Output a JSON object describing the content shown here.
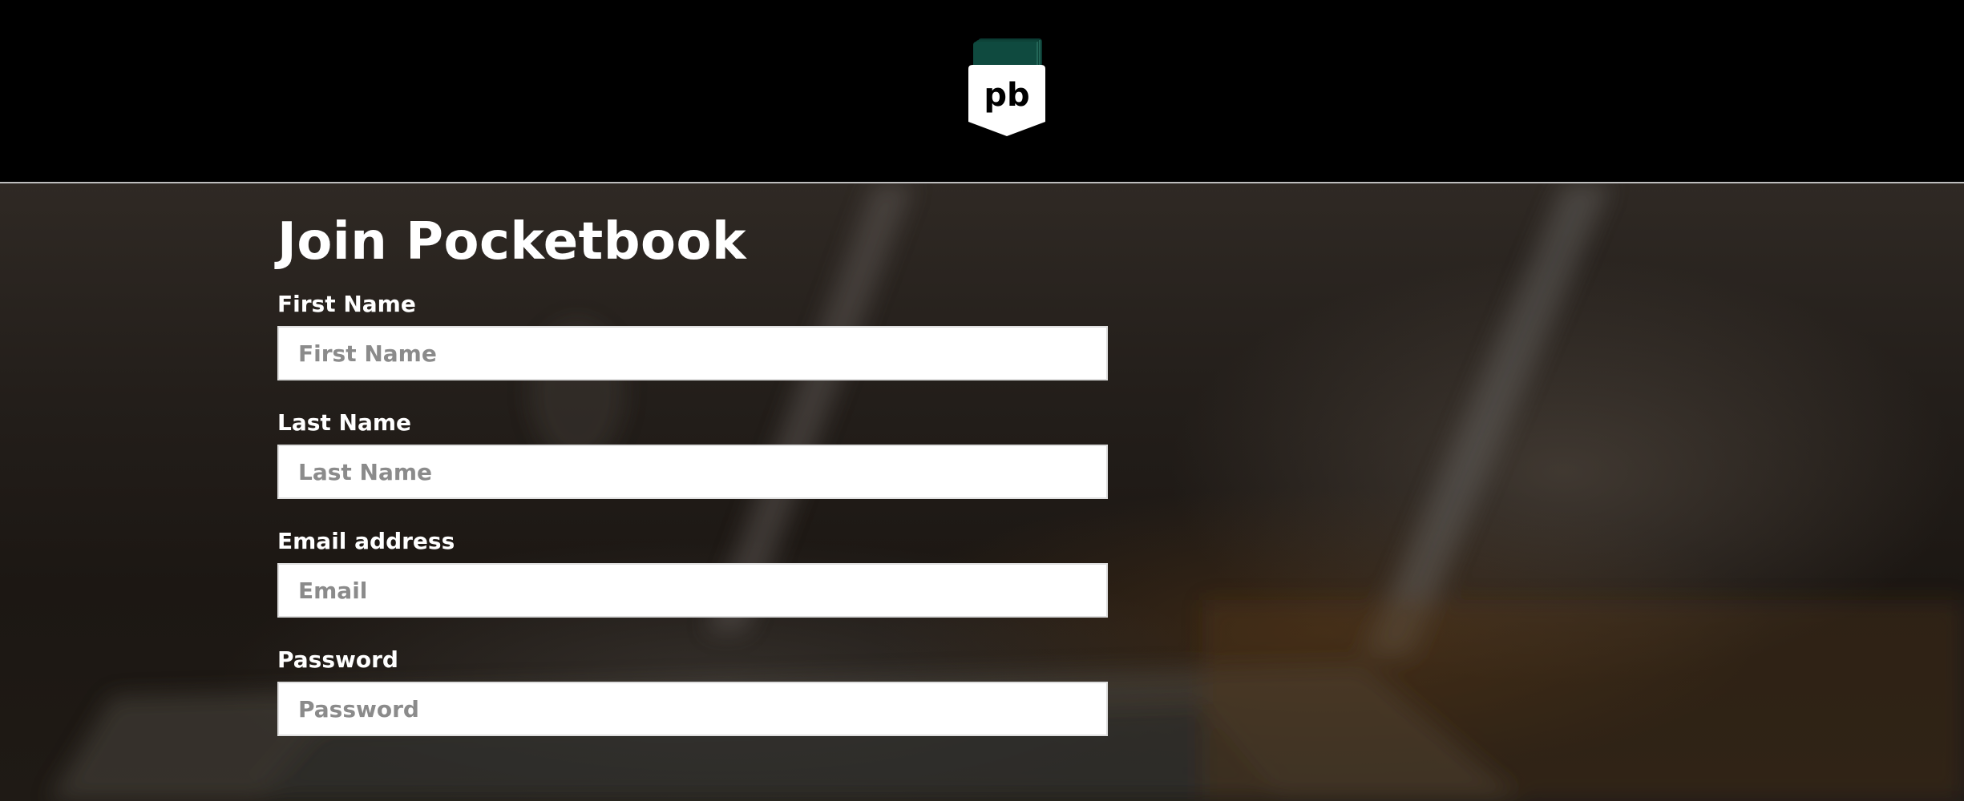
{
  "header": {
    "logo_text": "pb",
    "logo_colors": {
      "stack": "#0f4a3f",
      "badge": "#ffffff",
      "letters": "#000000"
    }
  },
  "form": {
    "title": "Join Pocketbook",
    "fields": [
      {
        "label": "First Name",
        "placeholder": "First Name",
        "value": ""
      },
      {
        "label": "Last Name",
        "placeholder": "Last Name",
        "value": ""
      },
      {
        "label": "Email address",
        "placeholder": "Email",
        "value": ""
      },
      {
        "label": "Password",
        "placeholder": "Password",
        "value": ""
      }
    ]
  }
}
